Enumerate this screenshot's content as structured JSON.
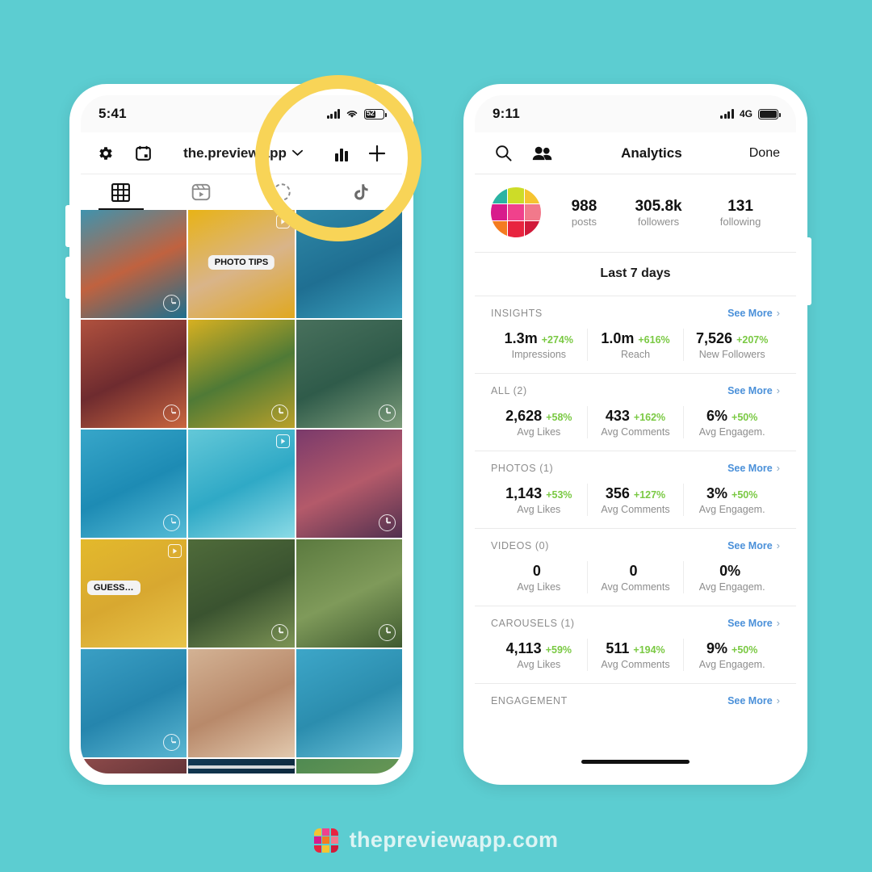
{
  "background_color": "#5ccdd1",
  "highlight_color": "#f8d457",
  "left_phone": {
    "status": {
      "time": "5:41",
      "battery_level": "52",
      "network_icon": "cellular-bars-icon",
      "wifi_icon": "wifi-icon"
    },
    "toolbar": {
      "settings_icon": "gear-icon",
      "calendar_icon": "calendar-icon",
      "account_name": "the.preview.app",
      "dropdown_icon": "chevron-down-icon",
      "analytics_icon": "bar-chart-icon",
      "add_icon": "plus-icon"
    },
    "tabs": [
      {
        "name": "grid",
        "icon": "grid-icon",
        "active": true
      },
      {
        "name": "reels",
        "icon": "reels-icon",
        "active": false
      },
      {
        "name": "stories",
        "icon": "stories-circle-icon",
        "active": false
      },
      {
        "name": "tiktok",
        "icon": "tiktok-icon",
        "active": false
      }
    ],
    "grid": [
      {
        "id": "cell-1",
        "caption": "",
        "badge": "",
        "clock": true,
        "c1": "#3f93ae",
        "c2": "#c0623f",
        "c3": "#1e6f8e"
      },
      {
        "id": "cell-2",
        "caption": "PHOTO TIPS",
        "badge": "reels-icon",
        "clock": false,
        "c1": "#e8b316",
        "c2": "#d9b489",
        "c3": "#e0a81f"
      },
      {
        "id": "cell-3",
        "caption": "",
        "badge": "",
        "clock": false,
        "c1": "#2e87a6",
        "c2": "#1f6f92",
        "c3": "#3aa0bd"
      },
      {
        "id": "cell-4",
        "caption": "",
        "badge": "",
        "clock": true,
        "c1": "#b0513e",
        "c2": "#6e2b2f",
        "c3": "#c9663f"
      },
      {
        "id": "cell-5",
        "caption": "",
        "badge": "",
        "clock": true,
        "c1": "#d7b021",
        "c2": "#4f7a36",
        "c3": "#b9a02a"
      },
      {
        "id": "cell-6",
        "caption": "",
        "badge": "",
        "clock": true,
        "c1": "#48705c",
        "c2": "#2f5b4a",
        "c3": "#7d9c7a"
      },
      {
        "id": "cell-7",
        "caption": "",
        "badge": "",
        "clock": true,
        "c1": "#37a6c9",
        "c2": "#1d8bb4",
        "c3": "#55bcd6"
      },
      {
        "id": "cell-8",
        "caption": "",
        "badge": "reels-icon",
        "clock": false,
        "c1": "#63c8d8",
        "c2": "#2fa9c6",
        "c3": "#8bdbe6"
      },
      {
        "id": "cell-9",
        "caption": "",
        "badge": "",
        "clock": true,
        "c1": "#7a3a6b",
        "c2": "#b45a6a",
        "c3": "#51304f"
      },
      {
        "id": "cell-10",
        "caption": "GUESS…",
        "badge": "reels-icon",
        "clock": false,
        "c1": "#e3b92c",
        "c2": "#d8a830",
        "c3": "#e8c44a"
      },
      {
        "id": "cell-11",
        "caption": "",
        "badge": "",
        "clock": true,
        "c1": "#4f6b3a",
        "c2": "#3a5330",
        "c3": "#7d9455"
      },
      {
        "id": "cell-12",
        "caption": "",
        "badge": "",
        "clock": true,
        "c1": "#5b7a3f",
        "c2": "#7f9a5a",
        "c3": "#3f5a30"
      },
      {
        "id": "cell-13",
        "caption": "",
        "badge": "",
        "clock": true,
        "c1": "#3a9fc4",
        "c2": "#2585ad",
        "c3": "#5bb7d2"
      },
      {
        "id": "cell-14",
        "caption": "",
        "badge": "",
        "clock": false,
        "c1": "#d3b294",
        "c2": "#b8896a",
        "c3": "#e2c9ae"
      },
      {
        "id": "cell-15",
        "caption": "",
        "badge": "",
        "clock": false,
        "c1": "#3da6c8",
        "c2": "#2b8dae",
        "c3": "#6ac2d8"
      },
      {
        "id": "cell-16",
        "caption": "",
        "badge": "",
        "clock": false,
        "c1": "#8d4a4a",
        "c2": "#5a2f34",
        "c3": "#b06a52"
      },
      {
        "id": "cell-17",
        "caption": "",
        "badge": "",
        "clock": false,
        "c1": "#123a55",
        "c2": "#0b2438",
        "c3": "#1f5a78"
      },
      {
        "id": "cell-18",
        "caption": "",
        "badge": "",
        "clock": false,
        "c1": "#4f8a52",
        "c2": "#6f9a55",
        "c3": "#8a5a38"
      }
    ]
  },
  "right_phone": {
    "status": {
      "time": "9:11",
      "network_label": "4G",
      "network_icon": "cellular-bars-icon",
      "battery_icon": "battery-full-icon"
    },
    "nav": {
      "search_icon": "search-icon",
      "people_icon": "people-icon",
      "title": "Analytics",
      "done_label": "Done"
    },
    "profile": {
      "avatar_icon": "preview-logo-avatar",
      "avatar_colors": [
        "#2bb3a3",
        "#cddc28",
        "#f5c431",
        "#d81b8c",
        "#f0418c",
        "#f2798b",
        "#f47b20",
        "#e8243f",
        "#d11a3a"
      ],
      "stats": [
        {
          "value": "988",
          "label": "posts"
        },
        {
          "value": "305.8k",
          "label": "followers"
        },
        {
          "value": "131",
          "label": "following"
        }
      ]
    },
    "date_range": "Last 7 days",
    "see_more_label": "See More",
    "chevron_icon": "chevron-right-icon",
    "sections": [
      {
        "title": "INSIGHTS",
        "metrics": [
          {
            "value": "1.3m",
            "delta": "+274%",
            "caption": "Impressions"
          },
          {
            "value": "1.0m",
            "delta": "+616%",
            "caption": "Reach"
          },
          {
            "value": "7,526",
            "delta": "+207%",
            "caption": "New Followers"
          }
        ]
      },
      {
        "title": "ALL (2)",
        "metrics": [
          {
            "value": "2,628",
            "delta": "+58%",
            "caption": "Avg Likes"
          },
          {
            "value": "433",
            "delta": "+162%",
            "caption": "Avg Comments"
          },
          {
            "value": "6%",
            "delta": "+50%",
            "caption": "Avg Engagem."
          }
        ]
      },
      {
        "title": "PHOTOS (1)",
        "metrics": [
          {
            "value": "1,143",
            "delta": "+53%",
            "caption": "Avg Likes"
          },
          {
            "value": "356",
            "delta": "+127%",
            "caption": "Avg Comments"
          },
          {
            "value": "3%",
            "delta": "+50%",
            "caption": "Avg Engagem."
          }
        ]
      },
      {
        "title": "VIDEOS (0)",
        "metrics": [
          {
            "value": "0",
            "delta": "",
            "caption": "Avg Likes"
          },
          {
            "value": "0",
            "delta": "",
            "caption": "Avg Comments"
          },
          {
            "value": "0%",
            "delta": "",
            "caption": "Avg Engagem."
          }
        ]
      },
      {
        "title": "CAROUSELS (1)",
        "metrics": [
          {
            "value": "4,113",
            "delta": "+59%",
            "caption": "Avg Likes"
          },
          {
            "value": "511",
            "delta": "+194%",
            "caption": "Avg Comments"
          },
          {
            "value": "9%",
            "delta": "+50%",
            "caption": "Avg Engagem."
          }
        ]
      },
      {
        "title": "ENGAGEMENT",
        "metrics": []
      }
    ]
  },
  "footer": {
    "logo_icon": "preview-logo-icon",
    "logo_colors": [
      "#f5c431",
      "#f0418c",
      "#e8243f",
      "#d81b8c",
      "#f47b20",
      "#f2798b",
      "#e8243f",
      "#f5c431",
      "#d11a3a"
    ],
    "text": "thepreviewapp.com"
  }
}
